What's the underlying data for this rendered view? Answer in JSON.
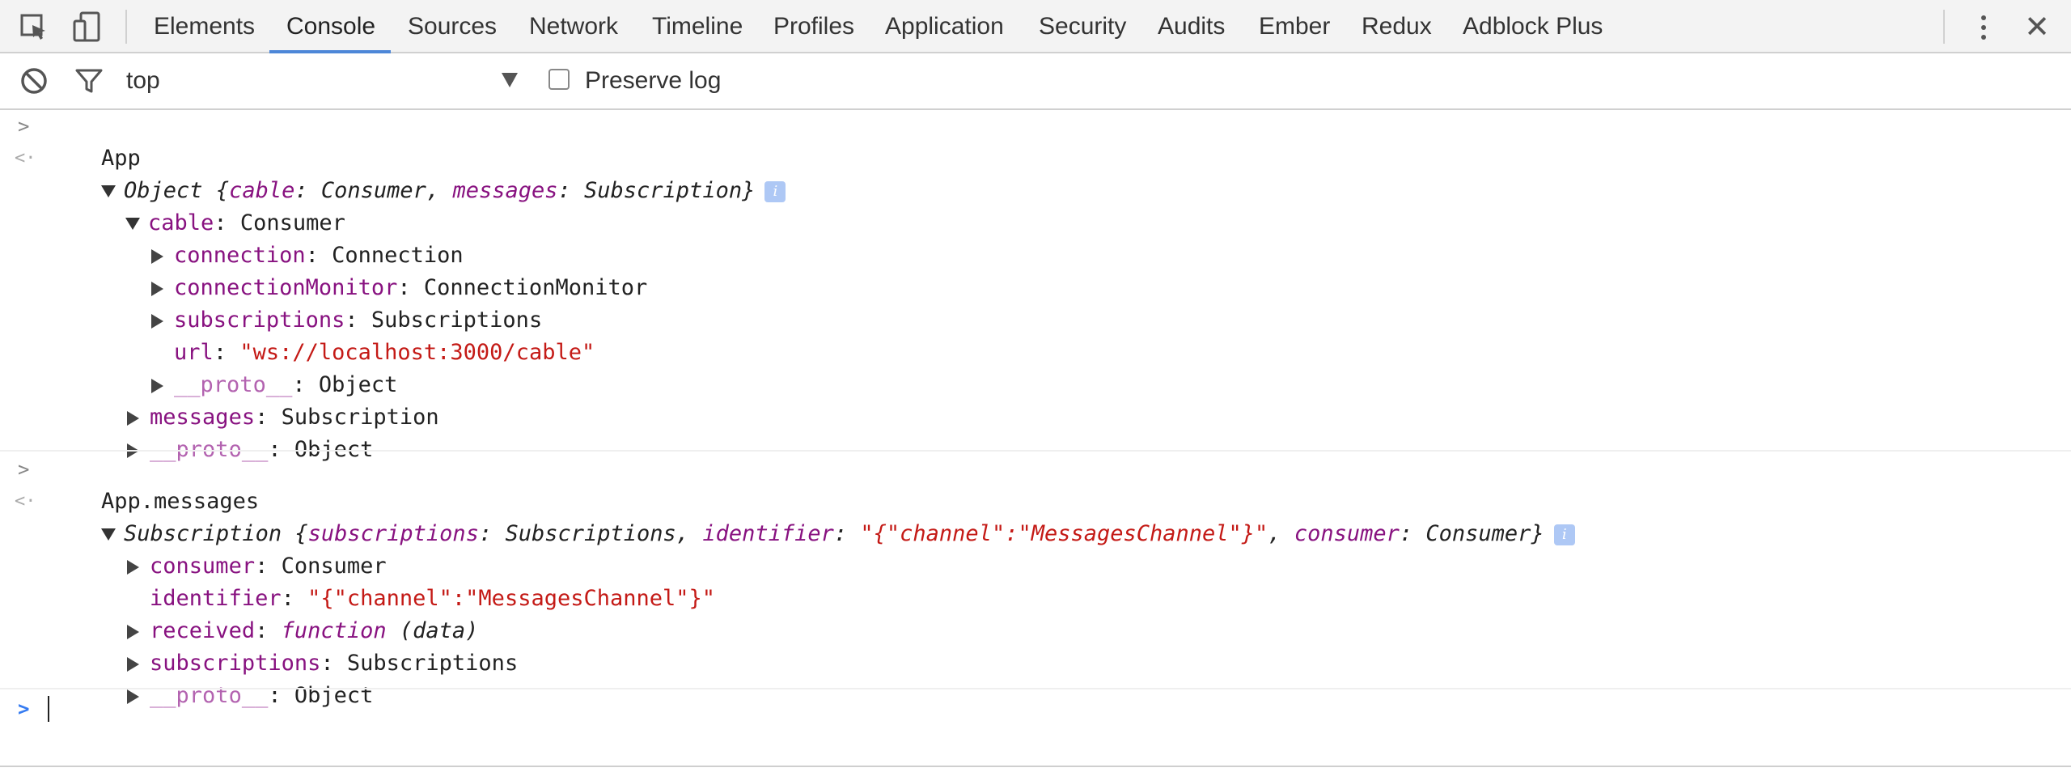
{
  "toolbar": {
    "tabs": [
      "Elements",
      "Console",
      "Sources",
      "Network",
      "Timeline",
      "Profiles",
      "Application",
      "Security",
      "Audits",
      "Ember",
      "Redux",
      "Adblock Plus"
    ],
    "active_tab": "Console",
    "close_label": "✕"
  },
  "filterbar": {
    "context": "top",
    "preserve_log_label": "Preserve log",
    "preserve_log_checked": false
  },
  "console": {
    "entry1": {
      "input": "App",
      "summary": {
        "type": "Object",
        "k1": "cable",
        "v1": "Consumer",
        "k2": "messages",
        "v2": "Subscription"
      },
      "cable_key": "cable",
      "cable_val": "Consumer",
      "connection_key": "connection",
      "connection_val": "Connection",
      "monitor_key": "connectionMonitor",
      "monitor_val": "ConnectionMonitor",
      "subs_key": "subscriptions",
      "subs_val": "Subscriptions",
      "url_key": "url",
      "url_val": "\"ws://localhost:3000/cable\"",
      "proto1_key": "__proto__",
      "proto1_val": "Object",
      "messages_key": "messages",
      "messages_val": "Subscription",
      "proto2_key": "__proto__",
      "proto2_val": "Object"
    },
    "entry2": {
      "input": "App.messages",
      "summary": {
        "type": "Subscription",
        "k1": "subscriptions",
        "v1": "Subscriptions",
        "k2": "identifier",
        "v2": "\"{\"channel\":\"MessagesChannel\"}\"",
        "k3": "consumer",
        "v3": "Consumer"
      },
      "consumer_key": "consumer",
      "consumer_val": "Consumer",
      "identifier_key": "identifier",
      "identifier_val": "\"{\"channel\":\"MessagesChannel\"}\"",
      "received_key": "received",
      "received_val_fn": "function",
      "received_val_args": "(data)",
      "subs_key": "subscriptions",
      "subs_val": "Subscriptions",
      "proto_key": "__proto__",
      "proto_val": "Object"
    },
    "info_badge": "i"
  },
  "colors": {
    "key": "#881280",
    "string": "#c41a16",
    "accent": "#4d87d8"
  }
}
